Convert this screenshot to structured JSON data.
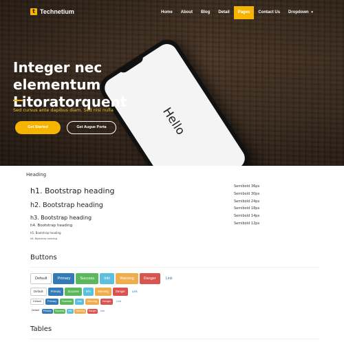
{
  "brand": {
    "logo_letter": "t",
    "name": "Technetium",
    "accent": "#f6b300"
  },
  "nav": {
    "items": [
      {
        "label": "Home"
      },
      {
        "label": "About"
      },
      {
        "label": "Blog"
      },
      {
        "label": "Detail"
      },
      {
        "label": "Pages",
        "active": true
      },
      {
        "label": "Contact Us"
      },
      {
        "label": "Dropdown"
      }
    ],
    "dropdown_caret": "▾"
  },
  "hero": {
    "title_line1": "Integer nec elementum",
    "title_line2": "Litoratorquent",
    "subtitle": "Sed cursus ante dapibus diam. Sed nisi nulla",
    "primary_button": "Get Started",
    "secondary_button": "Get Augue Porta",
    "phone_text": "Hello"
  },
  "typography": {
    "section_label": "Heading",
    "h1": "h1. Bootstrap heading",
    "h2": "h2. Bootstrap heading",
    "h3": "h3. Bootstrap heading",
    "h4": "h4. Bootstrap heading",
    "h5": "h5. Bootstrap heading",
    "h6": "h6. Bootstrap heading",
    "sizes": [
      "Semibold 36px",
      "Semibold 30px",
      "Semibold 24px",
      "Semibold 18px",
      "Semibold 14px",
      "Semibold 12px"
    ]
  },
  "buttons_section": {
    "title": "Buttons",
    "labels": {
      "default": "Default",
      "primary": "Primary",
      "success": "Success",
      "info": "Info",
      "warning": "Warning",
      "danger": "Danger",
      "link": "Link"
    }
  },
  "tables_section": {
    "title": "Tables"
  }
}
